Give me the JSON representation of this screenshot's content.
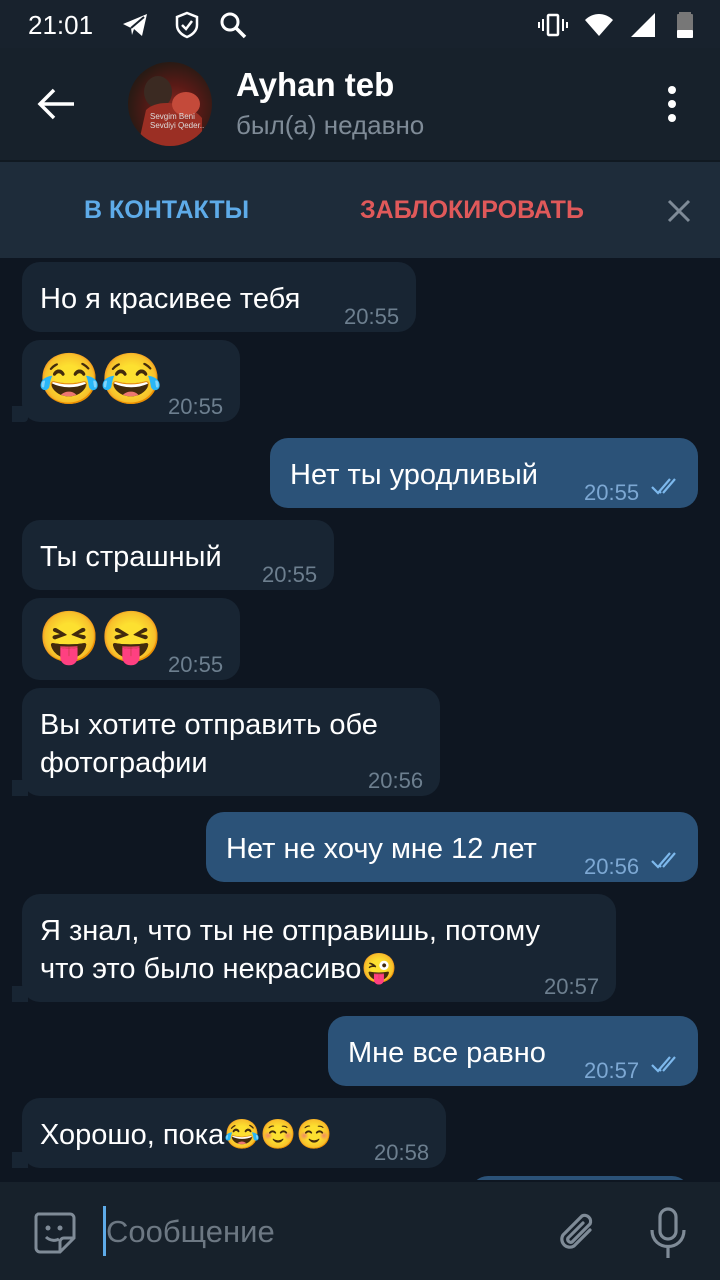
{
  "status_bar": {
    "time": "21:01",
    "icons": [
      "telegram-icon",
      "shield-icon",
      "search-icon",
      "vibrate-icon",
      "wifi-icon",
      "signal-icon",
      "battery-icon"
    ]
  },
  "header": {
    "title": "Ayhan teb",
    "subtitle": "был(а) недавно",
    "avatar_text": "Sevgim Beni\nSevdiyi Qeder..."
  },
  "action_bar": {
    "add_contact": "В КОНТАКТЫ",
    "block": "ЗАБЛОКИРОВАТЬ"
  },
  "messages": [
    {
      "dir": "in",
      "text": "Но я красивее тебя",
      "time": "20:55"
    },
    {
      "dir": "in",
      "text": "😂😂",
      "time": "20:55",
      "emoji_only": true
    },
    {
      "dir": "out",
      "text": "Нет ты уродливый",
      "time": "20:55",
      "read": true
    },
    {
      "dir": "in",
      "text": "Ты страшный",
      "time": "20:55"
    },
    {
      "dir": "in",
      "text": "😝😝",
      "time": "20:55",
      "emoji_only": true
    },
    {
      "dir": "in",
      "text_lines": [
        "Вы хотите отправить обе",
        "фотографии"
      ],
      "time": "20:56"
    },
    {
      "dir": "out",
      "text": "Нет не хочу мне 12 лет",
      "time": "20:56",
      "read": true
    },
    {
      "dir": "in",
      "text_lines": [
        "Я знал, что ты не отправишь, потому",
        "что это было некрасиво😜"
      ],
      "time": "20:57"
    },
    {
      "dir": "out",
      "text": "Мне все равно",
      "time": "20:57",
      "read": true
    },
    {
      "dir": "in",
      "text": "Хорошо, пока😂☺️☺️",
      "time": "20:58"
    }
  ],
  "composer": {
    "placeholder": "Сообщение"
  },
  "colors": {
    "background": "#0e1621",
    "incoming_bubble": "#182533",
    "outgoing_bubble": "#2b5278",
    "accent": "#5eabe8",
    "danger": "#e0595a"
  }
}
